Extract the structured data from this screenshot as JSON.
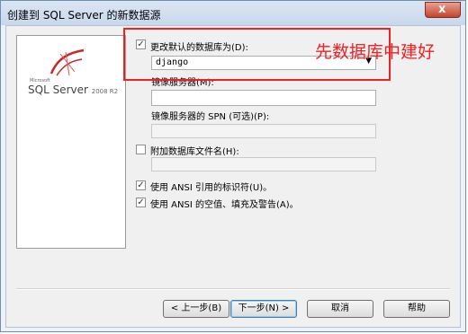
{
  "window": {
    "title": "创建到 SQL Server 的新数据源",
    "close_glyph": "x"
  },
  "logo": {
    "small_text": "Microsoft",
    "product": "SQL Server",
    "version": "2008 R2"
  },
  "form": {
    "change_default_db": {
      "label": "更改默认的数据库为(D):",
      "checked": true,
      "check_glyph": "✓"
    },
    "database_select": {
      "value": "django",
      "arrow": "▼"
    },
    "mirror_server": {
      "label": "镜像服务器(M):",
      "value": ""
    },
    "mirror_spn": {
      "label": "镜像服务器的 SPN (可选)(P):",
      "value": ""
    },
    "attach_db": {
      "label": "附加数据库文件名(H):",
      "checked": false,
      "check_glyph": ""
    },
    "attach_file": {
      "value": ""
    },
    "ansi_quoted": {
      "label": "使用 ANSI 引用的标识符(U)。",
      "checked": true,
      "check_glyph": "✓"
    },
    "ansi_nulls": {
      "label": "使用 ANSI 的空值、填充及警告(A)。",
      "checked": true,
      "check_glyph": "✓"
    }
  },
  "annotation": {
    "text": "先数据库中建好",
    "color": "#ee2222"
  },
  "buttons": {
    "back": "< 上一步(B)",
    "next": "下一步(N) >",
    "cancel": "取消",
    "help": "帮助"
  }
}
